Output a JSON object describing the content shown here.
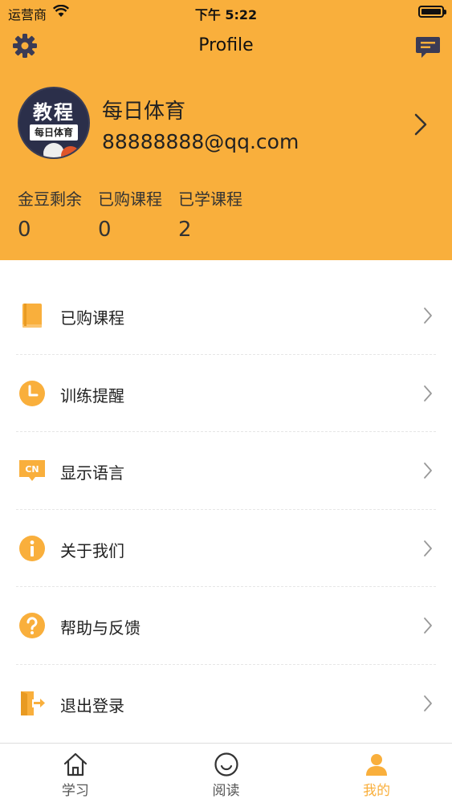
{
  "status_bar": {
    "carrier": "运营商",
    "time": "下午 5:22"
  },
  "nav": {
    "title": "Profile"
  },
  "profile": {
    "avatar_text_top": "教程",
    "avatar_text_bottom": "每日体育",
    "name": "每日体育",
    "email": "88888888@qq.com"
  },
  "stats": [
    {
      "label": "金豆剩余",
      "value": "0"
    },
    {
      "label": "已购课程",
      "value": "0"
    },
    {
      "label": "已学课程",
      "value": "2"
    }
  ],
  "menu": [
    {
      "label": "已购课程",
      "icon": "book-icon"
    },
    {
      "label": "训练提醒",
      "icon": "clock-icon"
    },
    {
      "label": "显示语言",
      "icon": "language-icon",
      "icon_text": "CN"
    },
    {
      "label": "关于我们",
      "icon": "info-icon"
    },
    {
      "label": "帮助与反馈",
      "icon": "help-icon"
    },
    {
      "label": "退出登录",
      "icon": "logout-icon"
    }
  ],
  "tabs": [
    {
      "label": "学习",
      "icon": "home-icon",
      "active": false
    },
    {
      "label": "阅读",
      "icon": "smiley-icon",
      "active": false
    },
    {
      "label": "我的",
      "icon": "person-icon",
      "active": true
    }
  ],
  "colors": {
    "accent": "#f9af3c",
    "dark_icon": "#3b3b55"
  }
}
